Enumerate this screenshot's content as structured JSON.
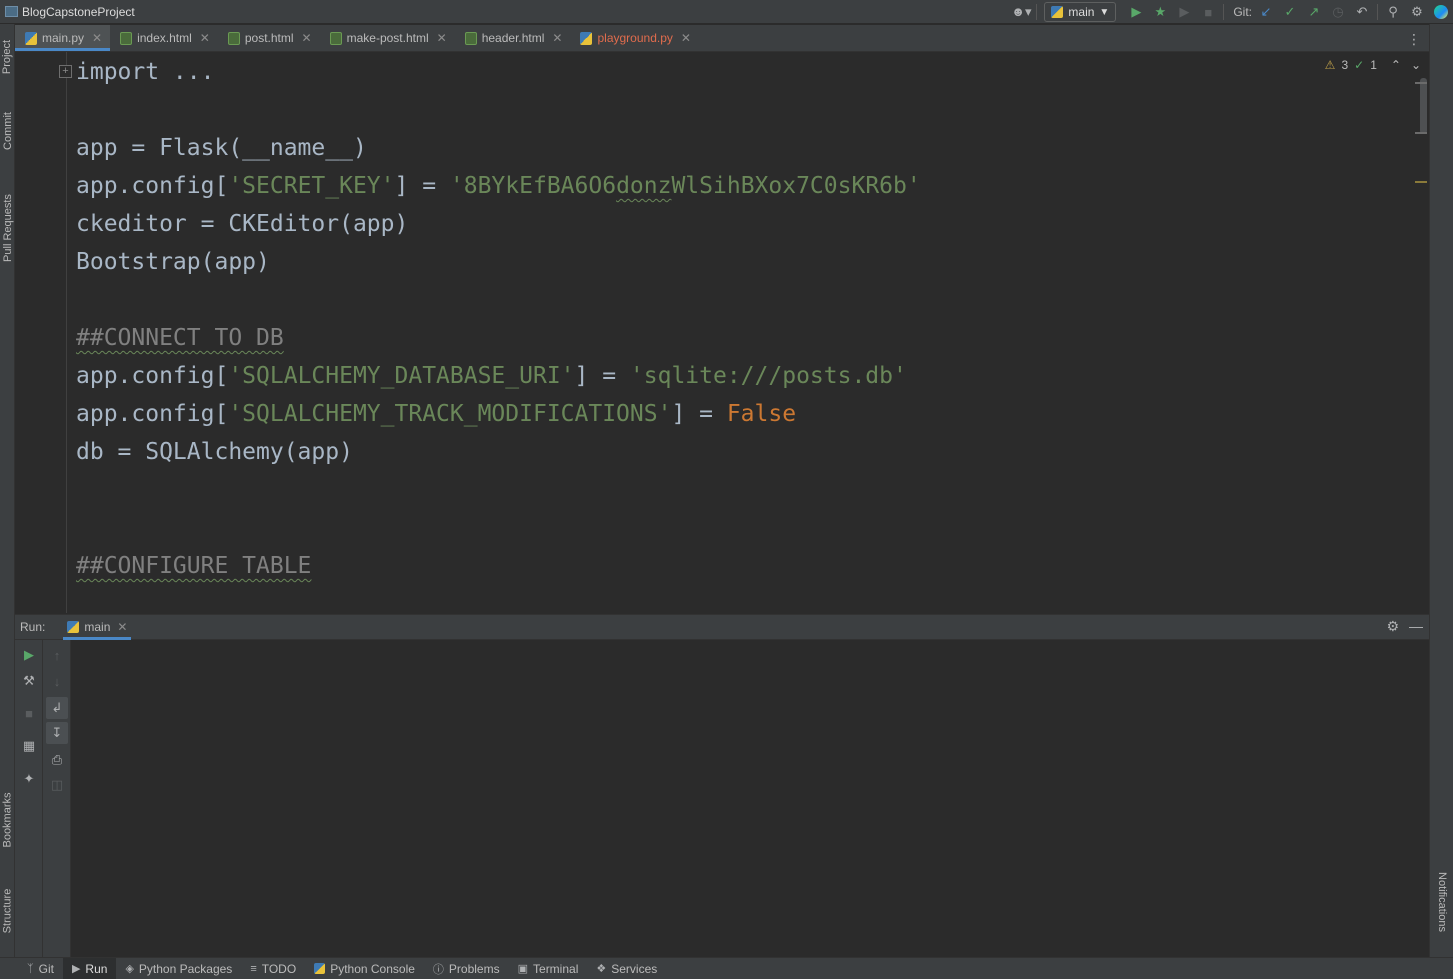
{
  "window": {
    "project_name": "BlogCapstoneProject"
  },
  "toolbar": {
    "branch": "main",
    "git_label": "Git:"
  },
  "tabs": [
    {
      "label": "main.py",
      "type": "py",
      "active": true
    },
    {
      "label": "index.html",
      "type": "html"
    },
    {
      "label": "post.html",
      "type": "html"
    },
    {
      "label": "make-post.html",
      "type": "html"
    },
    {
      "label": "header.html",
      "type": "html"
    },
    {
      "label": "playground.py",
      "type": "py",
      "error": true
    }
  ],
  "editor": {
    "inspection": {
      "warnings": "3",
      "ok": "1"
    },
    "lines": [
      {
        "a": "import ..."
      },
      {
        "a": "app = Flask(__name__)"
      },
      {
        "a": "app.config[",
        "s": "'SECRET_KEY'",
        "b": "] = ",
        "s2a": "'8BYkEfBA6O6",
        "s2t": "donz",
        "s2b": "WlSihBXox7C0sKR6b'"
      },
      {
        "a": "ckeditor = CKEditor(app)"
      },
      {
        "a": "Bootstrap(app)"
      },
      {
        "c": "##CONNECT TO DB"
      },
      {
        "a": "app.config[",
        "s": "'SQLALCHEMY_DATABASE_URI'",
        "b": "] = ",
        "s2": "'sqlite:///posts.db'"
      },
      {
        "a": "app.config[",
        "s": "'SQLALCHEMY_TRACK_MODIFICATIONS'",
        "b": "] = ",
        "k": "False"
      },
      {
        "a": "db = SQLAlchemy(app)"
      },
      {
        "c": "##CONFIGURE TABLE"
      }
    ]
  },
  "run_panel": {
    "label": "Run:",
    "tab": "main"
  },
  "left_strip": {
    "project": "Project",
    "commit": "Commit",
    "pull_requests": "Pull Requests",
    "bookmarks": "Bookmarks",
    "structure": "Structure"
  },
  "right_strip": {
    "notifications": "Notifications"
  },
  "statusbar": [
    {
      "label": "Git",
      "icon": "git-branch-icon"
    },
    {
      "label": "Run",
      "icon": "run-icon",
      "active": true
    },
    {
      "label": "Python Packages",
      "icon": "packages-icon"
    },
    {
      "label": "TODO",
      "icon": "todo-icon"
    },
    {
      "label": "Python Console",
      "icon": "python-console-icon"
    },
    {
      "label": "Problems",
      "icon": "problems-icon"
    },
    {
      "label": "Terminal",
      "icon": "terminal-icon"
    },
    {
      "label": "Services",
      "icon": "services-icon"
    }
  ],
  "colors": {
    "editor_bg": "#2b2b2b",
    "panel_bg": "#3c3f41",
    "accent": "#4a88c7",
    "string": "#6a8759",
    "keyword": "#cc7832",
    "text": "#a9b7c6"
  }
}
